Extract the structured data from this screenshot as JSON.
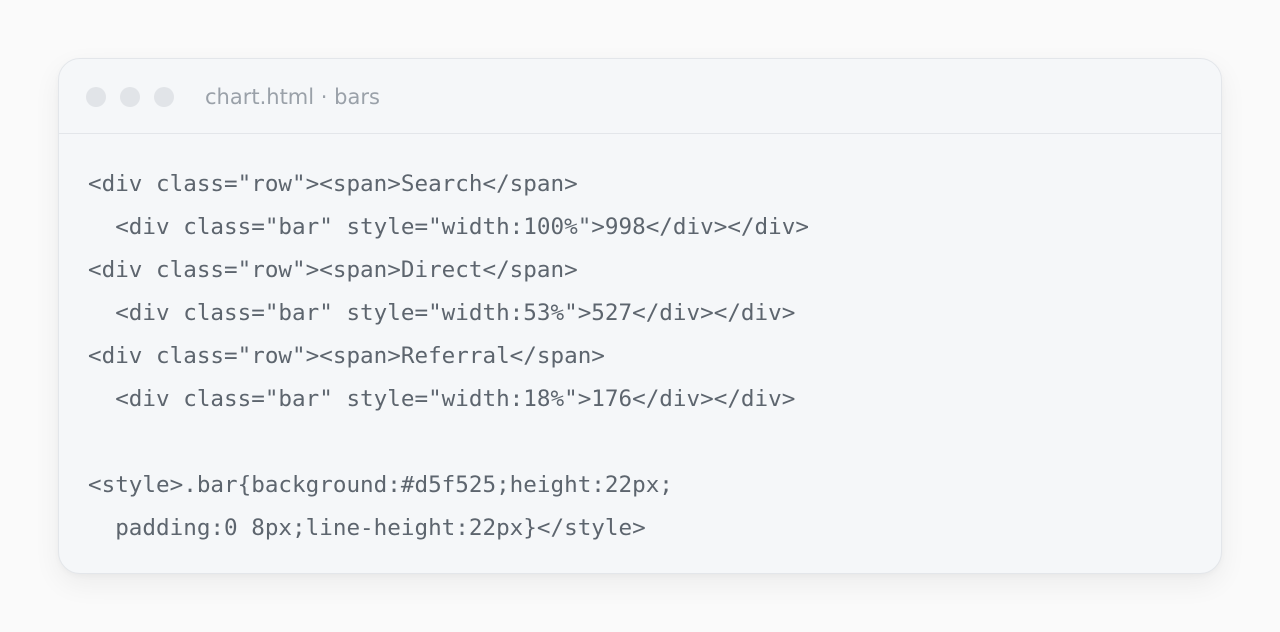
{
  "window": {
    "title": "chart.html · bars",
    "controls": [
      "close-dot",
      "minimize-dot",
      "maximize-dot"
    ]
  },
  "code": {
    "lines": [
      "<div class=\"row\"><span>Search</span>",
      "  <div class=\"bar\" style=\"width:100%\">998</div></div>",
      "<div class=\"row\"><span>Direct</span>",
      "  <div class=\"bar\" style=\"width:53%\">527</div></div>",
      "<div class=\"row\"><span>Referral</span>",
      "  <div class=\"bar\" style=\"width:18%\">176</div></div>",
      "",
      "<style>.bar{background:#d5f525;height:22px;",
      "  padding:0 8px;line-height:22px}</style>"
    ]
  },
  "colors": {
    "window_background": "#f5f7f9",
    "code_text": "#5d656e",
    "title_text": "#9aa1a9",
    "dot": "#e1e4e8"
  }
}
